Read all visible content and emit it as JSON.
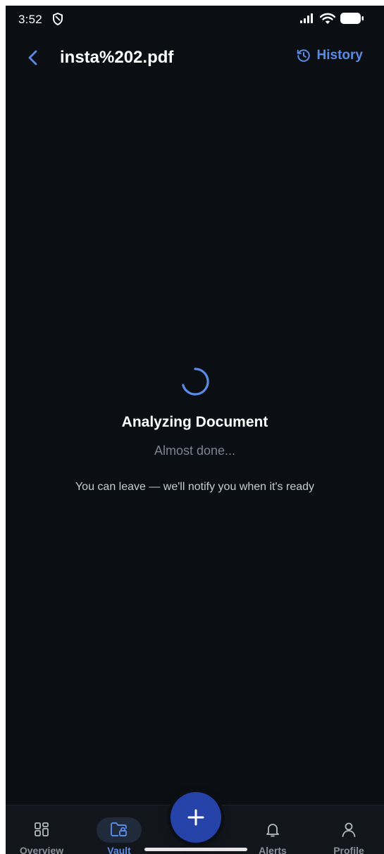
{
  "status_bar": {
    "time": "3:52",
    "icons": [
      "shield-icon",
      "signal-icon",
      "wifi-icon",
      "battery-icon"
    ]
  },
  "header": {
    "back_icon": "chevron-left-icon",
    "title": "insta%202.pdf",
    "history_icon": "history-icon",
    "history_label": "History"
  },
  "content": {
    "spinner_icon": "loading-spinner-icon",
    "title": "Analyzing Document",
    "subtitle": "Almost done...",
    "note": "You can leave — we'll notify you when it's ready"
  },
  "nav": {
    "items": [
      {
        "label": "Overview",
        "icon": "grid-icon",
        "active": false
      },
      {
        "label": "Vault",
        "icon": "folder-lock-icon",
        "active": true
      },
      {
        "label": "Alerts",
        "icon": "bell-icon",
        "active": false
      },
      {
        "label": "Profile",
        "icon": "user-icon",
        "active": false
      }
    ],
    "fab_icon": "plus-icon"
  },
  "colors": {
    "background": "#0b0f14",
    "accent": "#5b8be6",
    "fab": "#2442a8",
    "muted_text": "#7b8290"
  }
}
